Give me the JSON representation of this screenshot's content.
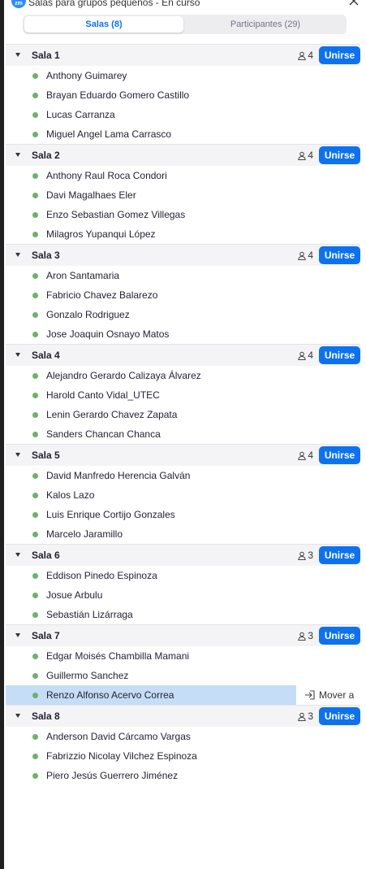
{
  "window": {
    "title": "Salas para grupos pequeños - En curso",
    "app_icon_text": "zm"
  },
  "tabs": [
    {
      "label": "Salas (8)",
      "active": true
    },
    {
      "label": "Participantes (29)",
      "active": false
    }
  ],
  "join_label": "Unirse",
  "move_label": "Mover a",
  "rooms": [
    {
      "name": "Sala 1",
      "count": "4",
      "members": [
        "Anthony Guimarey",
        "Brayan Eduardo Gomero Castillo",
        "Lucas Carranza",
        "Miguel Angel Lama Carrasco"
      ]
    },
    {
      "name": "Sala 2",
      "count": "4",
      "members": [
        "Anthony Raul Roca Condori",
        "Davi Magalhaes Eler",
        "Enzo Sebastian Gomez Villegas",
        "Milagros Yupanqui López"
      ]
    },
    {
      "name": "Sala 3",
      "count": "4",
      "members": [
        "Aron Santamaria",
        "Fabricio Chavez Balarezo",
        "Gonzalo Rodriguez",
        "Jose Joaquin Osnayo Matos"
      ]
    },
    {
      "name": "Sala 4",
      "count": "4",
      "members": [
        "Alejandro Gerardo Calizaya Álvarez",
        "Harold Canto Vidal_UTEC",
        "Lenin Gerardo Chavez Zapata",
        "Sanders Chancan Chanca"
      ]
    },
    {
      "name": "Sala 5",
      "count": "4",
      "members": [
        "David Manfredo Herencia Galván",
        "Kalos Lazo",
        "Luis Enrique Cortijo Gonzales",
        "Marcelo Jaramillo"
      ]
    },
    {
      "name": "Sala 6",
      "count": "3",
      "members": [
        "Eddison Pinedo Espinoza",
        "Josue Arbulu",
        "Sebastián Lizárraga"
      ]
    },
    {
      "name": "Sala 7",
      "count": "3",
      "members": [
        "Edgar Moisés Chambilla Mamani",
        "Guillermo Sanchez",
        "Renzo Alfonso Acervo Correa"
      ],
      "selected_index": 2
    },
    {
      "name": "Sala 8",
      "count": "3",
      "members": [
        "Anderson David Cárcamo Vargas",
        "Fabrizzio Nicolay Vilchez Espinoza",
        "Piero Jesús Guerrero Jiménez"
      ]
    }
  ],
  "colors": {
    "accent": "#0e72ed",
    "online_dot": "#6cb26b",
    "selected_row": "#c5ddf6",
    "header_bg": "#f4f4f6"
  },
  "icons": {
    "room_count": "person-icon",
    "move": "move-to-icon",
    "collapse": "caret-down-icon",
    "close": "close-icon"
  }
}
